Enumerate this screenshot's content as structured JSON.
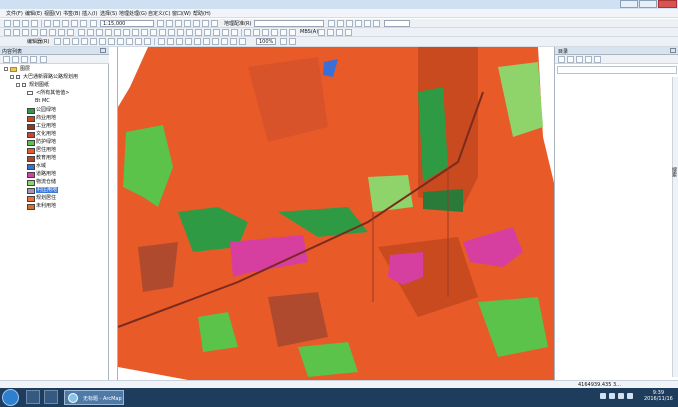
{
  "title": "",
  "menus": [
    "文件(F)",
    "编辑(E)",
    "视图(V)",
    "书签(B)",
    "插入(I)",
    "选择(S)",
    "地理处理(G)",
    "自定义(C)",
    "窗口(W)",
    "帮助(H)"
  ],
  "toolbar": {
    "scale_value": "1:15,000",
    "georef_label": "地理配准(R)",
    "editor_label": "编辑器(R)",
    "pct_value": "100%",
    "mosaic_label": "MBS(A)"
  },
  "toc": {
    "title": "内容列表",
    "root_label": "图层",
    "group_label": "大巴通新驿路公路规划用",
    "layer_label": "规划图纸",
    "sublayer_label": "<所有其他值>",
    "field_label": "Bt MC",
    "legend": [
      {
        "label": "公园绿地",
        "color": "#2e9b44"
      },
      {
        "label": "商业用地",
        "color": "#c84a1e"
      },
      {
        "label": "工业用地",
        "color": "#8b3a2a"
      },
      {
        "label": "文化用地",
        "color": "#d0402a"
      },
      {
        "label": "防护绿地",
        "color": "#5bc24a"
      },
      {
        "label": "居住用地",
        "color": "#e85a28"
      },
      {
        "label": "教育用地",
        "color": "#b04a2e"
      },
      {
        "label": "水域",
        "color": "#3a6fd8"
      },
      {
        "label": "道路用地",
        "color": "#d63fa0"
      },
      {
        "label": "物流仓储",
        "color": "#8fd46b"
      },
      {
        "label": "村庄用地",
        "color": "#9a9ab0"
      },
      {
        "label": "规划居住",
        "color": "#f07038"
      },
      {
        "label": "未利用地",
        "color": "#d97020"
      }
    ],
    "selected_index": 10
  },
  "right_panel": {
    "title": "目录",
    "side_tab": "搜索"
  },
  "status": {
    "coords": "4164939.435   3..."
  },
  "taskbar": {
    "task_label": "无标题 - ArcMap",
    "clock_time": "9:39",
    "clock_date": "2016/11/16"
  }
}
